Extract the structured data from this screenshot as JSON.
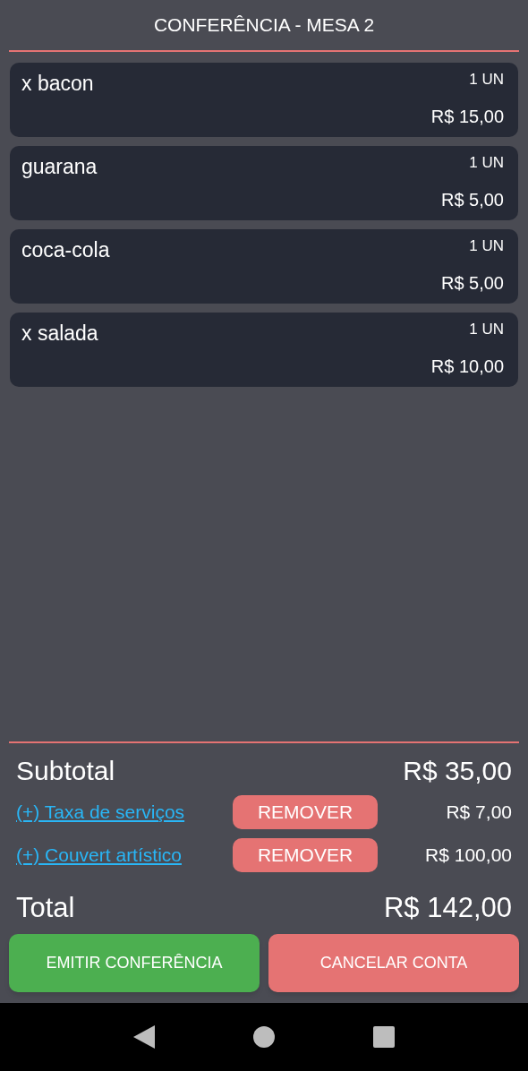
{
  "title": "CONFERÊNCIA - MESA 2",
  "items": [
    {
      "name": "x bacon",
      "quantity": "1 UN",
      "price": "R$ 15,00"
    },
    {
      "name": "guarana",
      "quantity": "1 UN",
      "price": "R$ 5,00"
    },
    {
      "name": "coca-cola",
      "quantity": "1 UN",
      "price": "R$ 5,00"
    },
    {
      "name": "x salada",
      "quantity": "1 UN",
      "price": "R$ 10,00"
    }
  ],
  "subtotal": {
    "label": "Subtotal",
    "value": "R$ 35,00"
  },
  "extras": [
    {
      "label": "(+) Taxa de serviços",
      "button": "REMOVER",
      "value": "R$ 7,00"
    },
    {
      "label": "(+) Couvert artístico",
      "button": "REMOVER",
      "value": "R$ 100,00"
    }
  ],
  "total": {
    "label": "Total",
    "value": "R$ 142,00"
  },
  "actions": [
    {
      "label": "EMITIR CONFERÊNCIA",
      "kind": "confirm"
    },
    {
      "label": "CANCELAR CONTA",
      "kind": "cancel"
    }
  ]
}
